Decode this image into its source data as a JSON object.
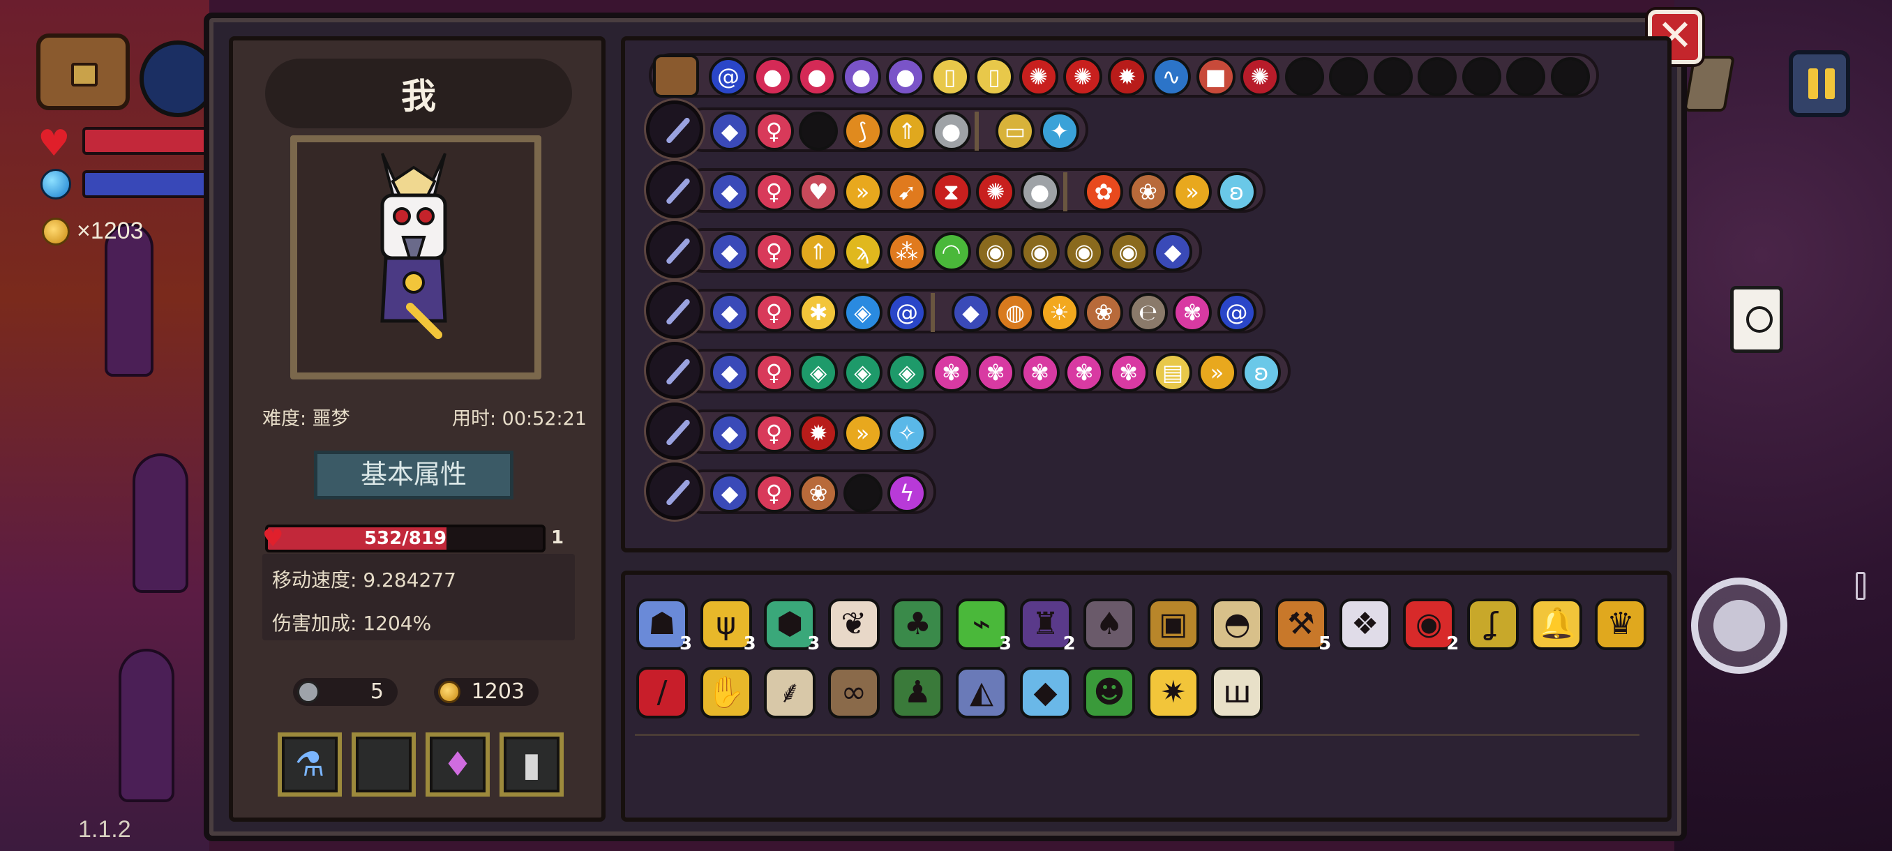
{
  "hud": {
    "coin_label": "×1203",
    "version": "1.1.2"
  },
  "panel": {
    "close_label": "✕"
  },
  "player": {
    "name": "我",
    "difficulty": "难度: 噩梦",
    "time": "用时: 00:52:21",
    "attributes_button": "基本属性",
    "hp": {
      "text": "532/819",
      "current": 532,
      "max": 819,
      "fraction": 0.65
    },
    "level": "1",
    "move_speed": "移动速度: 9.284277",
    "damage_bonus": "伤害加成: 1204%",
    "keys": "5",
    "coins": "1203"
  },
  "colors": {
    "accent_gold": "#f2c53a",
    "hp_red": "#c2283a",
    "mana_blue": "#3848b8",
    "close_red": "#c4262c"
  },
  "skill_rows": [
    {
      "weapon": "chest",
      "icons": [
        "spiral-icon",
        "strawberry-icon",
        "strawberry-icon",
        "grape-icon",
        "grape-icon",
        "card-icon",
        "card-icon",
        "vortex-icon",
        "vortex-icon",
        "fire-burst-icon",
        "snake-icon",
        "box-icon",
        "orb-icon",
        "empty",
        "empty",
        "empty",
        "empty",
        "empty",
        "empty",
        "empty"
      ]
    },
    {
      "weapon": "wand-1",
      "icons": [
        "gem-icon",
        "figure-icon",
        "empty",
        "bow-icon",
        "arrow-up-icon",
        "stone-icon",
        "divider",
        "mouse-icon",
        "crystal-icon"
      ]
    },
    {
      "weapon": "wand-2",
      "icons": [
        "gem-icon",
        "figure-icon",
        "heart-organ-icon",
        "double-chevron-icon",
        "flame-arrow-icon",
        "hourglass-icon",
        "vortex-icon",
        "stone-icon",
        "divider",
        "fire-flower-icon",
        "flower-icon",
        "double-chevron-icon",
        "butterfly-icon"
      ]
    },
    {
      "weapon": "wand-3",
      "icons": [
        "gem-icon",
        "figure-icon",
        "arrow-up-icon",
        "claw-icon",
        "tri-orb-icon",
        "rainbow-icon",
        "signal-icon",
        "signal-icon",
        "signal-icon",
        "signal-icon",
        "gem-icon"
      ]
    },
    {
      "weapon": "wand-4",
      "icons": [
        "gem-icon",
        "figure-icon",
        "puff-icon",
        "swirl-square-icon",
        "spiral-icon",
        "divider",
        "gem-icon",
        "planet-icon",
        "sun-icon",
        "flower-icon",
        "coil-icon",
        "petal-icon",
        "spiral-icon"
      ]
    },
    {
      "weapon": "wand-5",
      "icons": [
        "gem-icon",
        "figure-icon",
        "emerald-icon",
        "emerald-icon",
        "emerald-icon",
        "petal-icon",
        "petal-icon",
        "petal-icon",
        "petal-icon",
        "petal-icon",
        "book-icon",
        "double-chevron-icon",
        "butterfly-icon"
      ]
    },
    {
      "weapon": "wand-6",
      "icons": [
        "gem-icon",
        "figure-icon",
        "fire-burst-icon",
        "double-chevron-icon",
        "sparkle-icon"
      ]
    },
    {
      "weapon": "wand-7",
      "icons": [
        "gem-icon",
        "figure-icon",
        "flower-icon",
        "empty",
        "lightning-icon"
      ]
    }
  ],
  "items": {
    "row1": [
      {
        "icon": "ghost-badge-icon",
        "count": "3"
      },
      {
        "icon": "antler-icon",
        "count": "3"
      },
      {
        "icon": "die-icon",
        "count": "3"
      },
      {
        "icon": "feather-icon",
        "count": ""
      },
      {
        "icon": "sprout-icon",
        "count": ""
      },
      {
        "icon": "syringe-icon",
        "count": "3"
      },
      {
        "icon": "cloak-icon",
        "count": "2"
      },
      {
        "icon": "armor-icon",
        "count": ""
      },
      {
        "icon": "crate-icon",
        "count": ""
      },
      {
        "icon": "bread-icon",
        "count": ""
      },
      {
        "icon": "pickaxe-icon",
        "count": "5"
      },
      {
        "icon": "crystal-shard-icon",
        "count": ""
      },
      {
        "icon": "red-eye-icon",
        "count": "2"
      },
      {
        "icon": "worm-icon",
        "count": ""
      },
      {
        "icon": "bell-icon",
        "count": ""
      },
      {
        "icon": "chalice-icon",
        "count": ""
      }
    ],
    "row2": [
      {
        "icon": "red-scarf-icon"
      },
      {
        "icon": "gauntlet-icon"
      },
      {
        "icon": "quill-icon"
      },
      {
        "icon": "bone-icon"
      },
      {
        "icon": "boot-icon"
      },
      {
        "icon": "ore-icon"
      },
      {
        "icon": "diamond-icon"
      },
      {
        "icon": "frog-icon"
      },
      {
        "icon": "gold-crystal-icon"
      },
      {
        "icon": "jaw-icon"
      }
    ]
  }
}
